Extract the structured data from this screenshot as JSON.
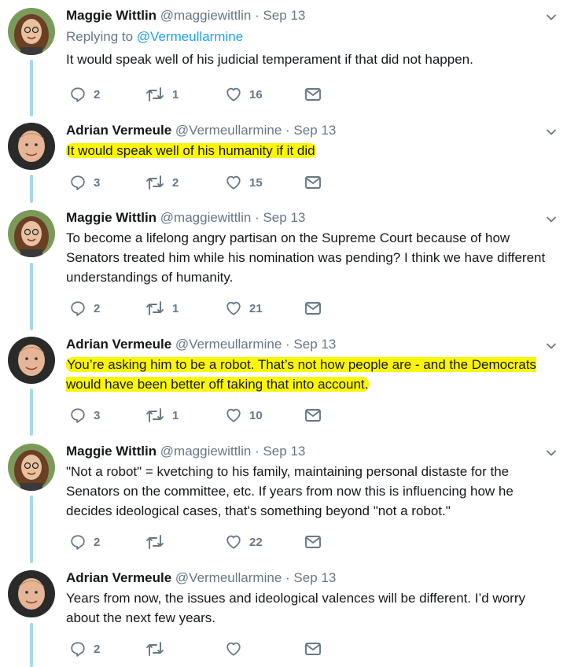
{
  "colors": {
    "thread_line": "#a6d8f0",
    "mention": "#1da1f2",
    "highlight": "#fbf606",
    "muted": "#657786"
  },
  "icons": [
    "reply-icon",
    "retweet-icon",
    "like-icon",
    "dm-icon",
    "chevron-down-icon"
  ],
  "tweets": [
    {
      "author": "Maggie Wittlin",
      "handle": "@maggiewittlin",
      "separator": "·",
      "date": "Sep 13",
      "replying_prefix": "Replying to",
      "replying_to": "@Vermeullarmine",
      "text_before": "It would speak well of his judicial temperament if that did not happen.",
      "highlight": "",
      "text_after": "",
      "replies": "2",
      "retweets": "1",
      "likes": "16"
    },
    {
      "author": "Adrian Vermeule",
      "handle": "@Vermeullarmine",
      "separator": "·",
      "date": "Sep 13",
      "text_before": "",
      "highlight": "It would speak well of his humanity if it did",
      "text_after": "",
      "replies": "3",
      "retweets": "2",
      "likes": "15"
    },
    {
      "author": "Maggie Wittlin",
      "handle": "@maggiewittlin",
      "separator": "·",
      "date": "Sep 13",
      "text_before": "To become a lifelong angry partisan on the Supreme Court because of how Senators treated him while his nomination was pending? I think we have different understandings of humanity.",
      "highlight": "",
      "text_after": "",
      "replies": "2",
      "retweets": "1",
      "likes": "21"
    },
    {
      "author": "Adrian Vermeule",
      "handle": "@Vermeullarmine",
      "separator": "·",
      "date": "Sep 13",
      "text_before": "",
      "highlight": "You’re asking him to be a robot. That’s not how people are - and the Democrats would have been better off taking that into account.",
      "text_after": "",
      "replies": "3",
      "retweets": "1",
      "likes": "10"
    },
    {
      "author": "Maggie Wittlin",
      "handle": "@maggiewittlin",
      "separator": "·",
      "date": "Sep 13",
      "text_before": "\"Not a robot\" = kvetching to his family, maintaining personal distaste for the Senators on the committee, etc. If years from now this is influencing how he decides ideological cases, that's something beyond \"not a robot.\"",
      "highlight": "",
      "text_after": "",
      "replies": "2",
      "retweets": "",
      "likes": "22"
    },
    {
      "author": "Adrian Vermeule",
      "handle": "@Vermeullarmine",
      "separator": "·",
      "date": "Sep 13",
      "text_before": "Years from now, the issues and ideological valences will be different. I’d worry about the next few years.",
      "highlight": "",
      "text_after": "",
      "replies": "2",
      "retweets": "",
      "likes": ""
    }
  ]
}
